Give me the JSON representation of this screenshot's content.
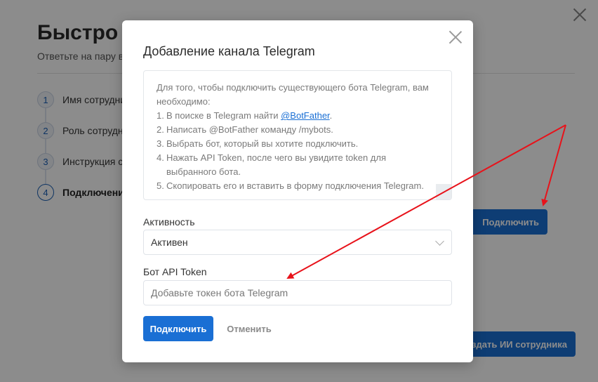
{
  "background": {
    "title": "Быстро с",
    "subtitle": "Ответьте на пару в",
    "steps": [
      {
        "num": "1",
        "label": "Имя сотрудни"
      },
      {
        "num": "2",
        "label": "Роль сотрудн"
      },
      {
        "num": "3",
        "label": "Инструкция со"
      },
      {
        "num": "4",
        "label": "Подключение"
      }
    ],
    "connect_button": "Подключить",
    "create_button": "оздать ИИ сотрудника"
  },
  "modal": {
    "title": "Добавление канала Telegram",
    "intro": "Для того, чтобы подключить существующего бота Telegram, вам необходимо:",
    "steps": [
      {
        "n": "1.",
        "text": "В поиске в Telegram найти ",
        "link": "@BotFather",
        "suffix": "."
      },
      {
        "n": "2.",
        "text": "Написать @BotFather команду /mybots."
      },
      {
        "n": "3.",
        "text": "Выбрать бот, который вы хотите подключить."
      },
      {
        "n": "4.",
        "text": "Нажать API Token, после чего вы увидите token для выбранного бота."
      },
      {
        "n": "5.",
        "text": "Скопировать его и вставить в форму подключения Telegram."
      }
    ],
    "activity_label": "Активность",
    "activity_value": "Активен",
    "token_label": "Бот API Token",
    "token_placeholder": "Добавьте токен бота Telegram",
    "token_value": "",
    "submit_label": "Подключить",
    "cancel_label": "Отменить"
  },
  "colors": {
    "accent": "#1a6fd4",
    "annotation_arrow": "#e8121a"
  },
  "icons": {
    "close": "close-icon",
    "dropdown": "chevron-down-icon"
  }
}
